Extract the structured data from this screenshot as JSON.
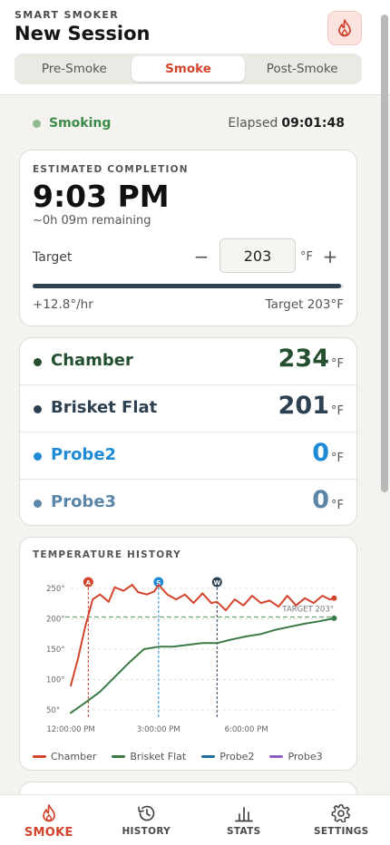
{
  "header": {
    "eyebrow": "SMART SMOKER",
    "title": "New Session",
    "tabs": [
      {
        "label": "Pre-Smoke",
        "active": false
      },
      {
        "label": "Smoke",
        "active": true
      },
      {
        "label": "Post-Smoke",
        "active": false
      }
    ]
  },
  "status": {
    "state": "Smoking",
    "elapsed_label": "Elapsed",
    "elapsed_value": "09:01:48"
  },
  "estimate": {
    "label": "ESTIMATED COMPLETION",
    "time": "9:03 PM",
    "remaining": "~0h 09m remaining",
    "target_label": "Target",
    "target_value": "203",
    "unit": "°F",
    "minus": "−",
    "plus": "+",
    "progress_fraction": 0.99,
    "rate": "+12.8°/hr",
    "target_readout": "Target 203°F"
  },
  "probes": [
    {
      "name": "Chamber",
      "value": "234",
      "unit": "°F",
      "color": "#25502f"
    },
    {
      "name": "Brisket Flat",
      "value": "201",
      "unit": "°F",
      "color": "#2d4152"
    },
    {
      "name": "Probe2",
      "value": "0",
      "unit": "°F",
      "color": "#1f8ad6"
    },
    {
      "name": "Probe3",
      "value": "0",
      "unit": "°F",
      "color": "#5b86a8"
    }
  ],
  "history": {
    "label": "TEMPERATURE HISTORY",
    "chart_data": {
      "type": "line",
      "x_ticks": [
        "12:00:00 PM",
        "3:00:00 PM",
        "6:00:00 PM"
      ],
      "y_ticks": [
        "50°",
        "100°",
        "150°",
        "200°",
        "250°"
      ],
      "ylim": [
        35,
        265
      ],
      "xlim_hours": [
        12.0,
        21.05
      ],
      "grid": true,
      "target_line": {
        "value": 203,
        "label": "TARGET 203°"
      },
      "markers": [
        {
          "label": "A",
          "hour": 12.6,
          "color": "#d4432c"
        },
        {
          "label": "S",
          "hour": 15.0,
          "color": "#1f8ad6"
        },
        {
          "label": "W",
          "hour": 17.0,
          "color": "#2d4152"
        }
      ],
      "series": [
        {
          "name": "Chamber",
          "color": "#d4432c",
          "points": [
            [
              12.0,
              90
            ],
            [
              12.25,
              135
            ],
            [
              12.5,
              188
            ],
            [
              12.75,
              232
            ],
            [
              13.0,
              240
            ],
            [
              13.3,
              228
            ],
            [
              13.5,
              252
            ],
            [
              13.8,
              246
            ],
            [
              14.1,
              256
            ],
            [
              14.3,
              244
            ],
            [
              14.6,
              240
            ],
            [
              14.85,
              245
            ],
            [
              15.0,
              256
            ],
            [
              15.3,
              240
            ],
            [
              15.6,
              232
            ],
            [
              15.9,
              240
            ],
            [
              16.2,
              226
            ],
            [
              16.5,
              242
            ],
            [
              16.8,
              226
            ],
            [
              17.0,
              228
            ],
            [
              17.3,
              214
            ],
            [
              17.6,
              232
            ],
            [
              17.9,
              222
            ],
            [
              18.2,
              238
            ],
            [
              18.5,
              226
            ],
            [
              18.8,
              230
            ],
            [
              19.1,
              220
            ],
            [
              19.4,
              238
            ],
            [
              19.7,
              222
            ],
            [
              20.0,
              234
            ],
            [
              20.3,
              226
            ],
            [
              20.6,
              238
            ],
            [
              20.85,
              232
            ],
            [
              21.0,
              234
            ]
          ]
        },
        {
          "name": "Brisket Flat",
          "color": "#3a7a45",
          "points": [
            [
              12.0,
              45
            ],
            [
              12.5,
              62
            ],
            [
              13.0,
              80
            ],
            [
              13.5,
              104
            ],
            [
              14.0,
              128
            ],
            [
              14.5,
              150
            ],
            [
              15.0,
              154
            ],
            [
              15.5,
              154
            ],
            [
              16.0,
              157
            ],
            [
              16.5,
              160
            ],
            [
              17.0,
              160
            ],
            [
              17.5,
              166
            ],
            [
              18.0,
              171
            ],
            [
              18.5,
              175
            ],
            [
              19.0,
              182
            ],
            [
              19.5,
              187
            ],
            [
              20.0,
              192
            ],
            [
              20.5,
              196
            ],
            [
              21.0,
              201
            ]
          ]
        },
        {
          "name": "Probe2",
          "color": "#1f6f9e",
          "points": []
        },
        {
          "name": "Probe3",
          "color": "#8a5ec7",
          "points": []
        }
      ]
    }
  },
  "tabbar": [
    {
      "label": "SMOKE",
      "icon": "flame-icon",
      "active": true
    },
    {
      "label": "HISTORY",
      "icon": "history-icon",
      "active": false
    },
    {
      "label": "STATS",
      "icon": "stats-icon",
      "active": false
    },
    {
      "label": "SETTINGS",
      "icon": "gear-icon",
      "active": false
    }
  ],
  "colors": {
    "accent": "#d4432c",
    "status_green": "#3d8b48",
    "progress": "#2d4152"
  }
}
